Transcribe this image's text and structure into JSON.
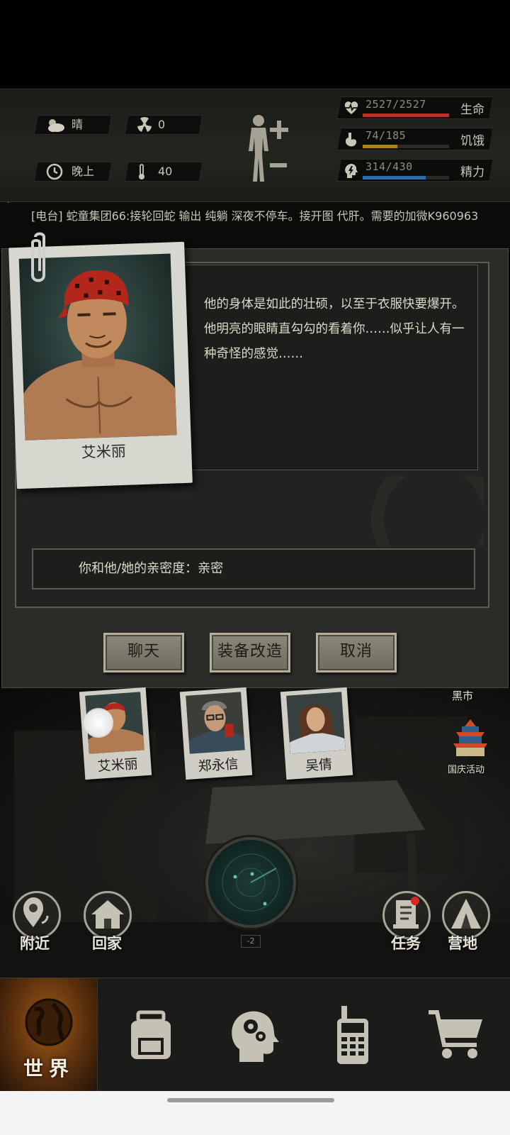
{
  "status": {
    "weather": "晴",
    "radiation": "0",
    "time_of_day": "晚上",
    "temperature": "40",
    "bars": [
      {
        "value": "2527/2527",
        "label": "生命",
        "fill": 1.0,
        "color": "#b8322a",
        "icon": "heart-pulse-icon"
      },
      {
        "value": "74/185",
        "label": "饥饿",
        "fill": 0.4,
        "color": "#b0801e",
        "icon": "stomach-icon"
      },
      {
        "value": "314/430",
        "label": "精力",
        "fill": 0.73,
        "color": "#2f6fa8",
        "icon": "lightning-head-icon"
      }
    ]
  },
  "radio": {
    "text": "[电台] 蛇童集团66:接轮回蛇 输出 纯躺 深夜不停车。接开图 代肝。需要的加微K960963"
  },
  "dialog": {
    "npc_name": "艾米丽",
    "description": "他的身体是如此的壮硕，以至于衣服快要爆开。他明亮的眼睛直勾勾的看着你……似乎让人有一种奇怪的感觉……",
    "intimacy": "你和他/她的亲密度：亲密",
    "buttons": {
      "chat": "聊天",
      "equip": "装备改造",
      "cancel": "取消"
    }
  },
  "scene": {
    "npcs": [
      {
        "name": "艾米丽"
      },
      {
        "name": "郑永信"
      },
      {
        "name": "吴倩"
      }
    ],
    "black_market": "黑市",
    "national_day_event": "国庆活动",
    "nearby": "附近",
    "go_home": "回家",
    "tasks": "任务",
    "camp": "营地",
    "radar_level": "-2"
  },
  "nav": {
    "world": "世界"
  }
}
